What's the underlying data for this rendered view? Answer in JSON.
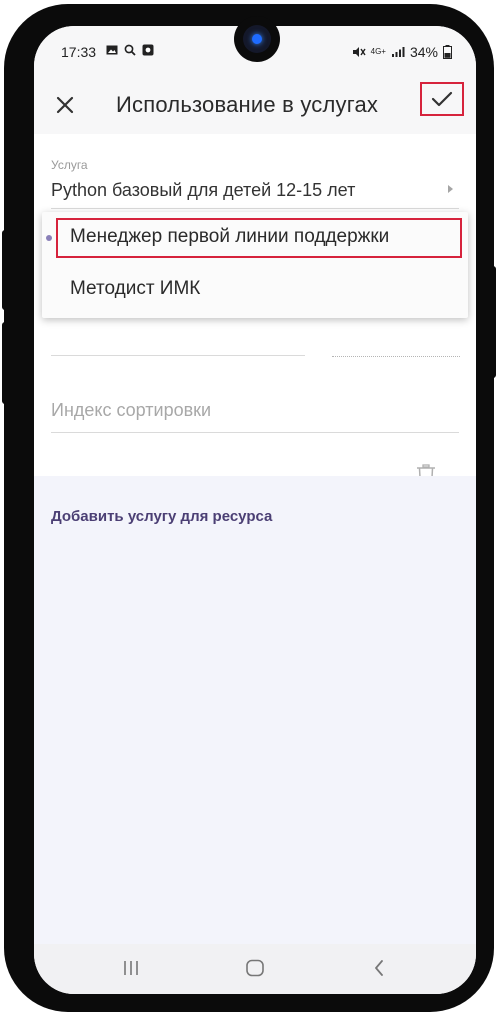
{
  "status_bar": {
    "time": "17:33",
    "network": "4G+",
    "battery": "34%"
  },
  "app_bar": {
    "title": "Использование в услугах",
    "close_icon": "close-icon",
    "confirm_icon": "check-icon"
  },
  "form": {
    "service_label": "Услуга",
    "service_value": "Python базовый для детей 12-15 лет",
    "sort_index_placeholder": "Индекс сортировки",
    "delete_icon": "trash-icon"
  },
  "dropdown": {
    "items": [
      {
        "label": "Менеджер первой линии поддержки"
      },
      {
        "label": "Методист ИМК"
      }
    ]
  },
  "add_service_link": "Добавить услугу для ресурса",
  "nav_bar": {
    "recent_icon": "recent-apps-icon",
    "home_icon": "home-icon",
    "back_icon": "back-icon"
  },
  "colors": {
    "accent": "#4b3f74",
    "highlight": "#d6233c",
    "lower_bg": "#f3f4fb"
  }
}
